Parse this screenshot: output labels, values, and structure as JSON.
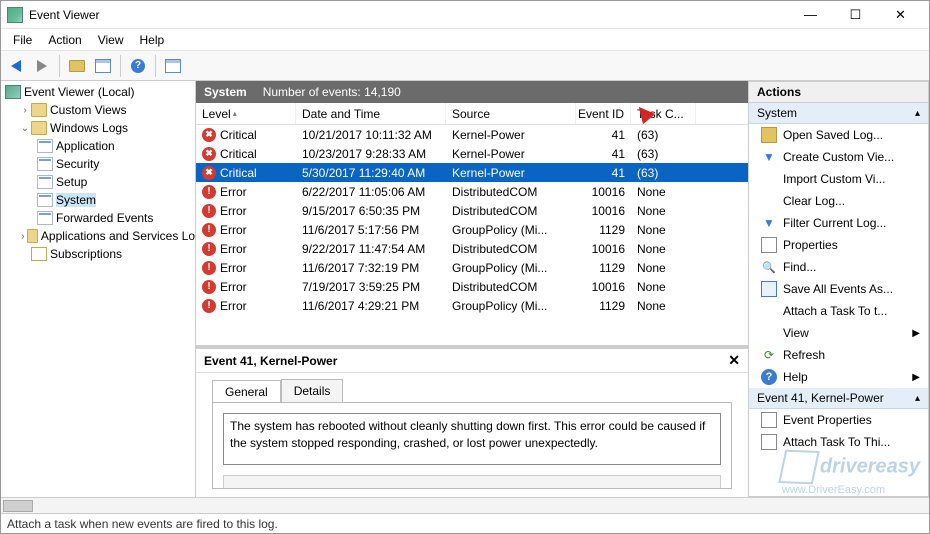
{
  "window": {
    "title": "Event Viewer"
  },
  "menu": [
    "File",
    "Action",
    "View",
    "Help"
  ],
  "tree": {
    "root": "Event Viewer (Local)",
    "custom_views": "Custom Views",
    "windows_logs": "Windows Logs",
    "logs": [
      "Application",
      "Security",
      "Setup",
      "System",
      "Forwarded Events"
    ],
    "app_svc": "Applications and Services Lo",
    "subs": "Subscriptions"
  },
  "center": {
    "title": "System",
    "count_label": "Number of events: 14,190",
    "columns": {
      "level": "Level",
      "date": "Date and Time",
      "source": "Source",
      "id": "Event ID",
      "task": "Task C..."
    },
    "rows": [
      {
        "level": "Critical",
        "icon": "crit",
        "date": "10/21/2017 10:11:32 AM",
        "source": "Kernel-Power",
        "id": "41",
        "task": "(63)"
      },
      {
        "level": "Critical",
        "icon": "crit",
        "date": "10/23/2017 9:28:33 AM",
        "source": "Kernel-Power",
        "id": "41",
        "task": "(63)"
      },
      {
        "level": "Critical",
        "icon": "crit",
        "date": "5/30/2017 11:29:40 AM",
        "source": "Kernel-Power",
        "id": "41",
        "task": "(63)",
        "selected": true
      },
      {
        "level": "Error",
        "icon": "err",
        "date": "6/22/2017 11:05:06 AM",
        "source": "DistributedCOM",
        "id": "10016",
        "task": "None"
      },
      {
        "level": "Error",
        "icon": "err",
        "date": "9/15/2017 6:50:35 PM",
        "source": "DistributedCOM",
        "id": "10016",
        "task": "None"
      },
      {
        "level": "Error",
        "icon": "err",
        "date": "11/6/2017 5:17:56 PM",
        "source": "GroupPolicy (Mi...",
        "id": "1129",
        "task": "None"
      },
      {
        "level": "Error",
        "icon": "err",
        "date": "9/22/2017 11:47:54 AM",
        "source": "DistributedCOM",
        "id": "10016",
        "task": "None"
      },
      {
        "level": "Error",
        "icon": "err",
        "date": "11/6/2017 7:32:19 PM",
        "source": "GroupPolicy (Mi...",
        "id": "1129",
        "task": "None"
      },
      {
        "level": "Error",
        "icon": "err",
        "date": "7/19/2017 3:59:25 PM",
        "source": "DistributedCOM",
        "id": "10016",
        "task": "None"
      },
      {
        "level": "Error",
        "icon": "err",
        "date": "11/6/2017 4:29:21 PM",
        "source": "GroupPolicy (Mi...",
        "id": "1129",
        "task": "None"
      }
    ],
    "details_title": "Event 41, Kernel-Power",
    "tab_general": "General",
    "tab_details": "Details",
    "message": "The system has rebooted without cleanly shutting down first. This error could be caused if the system stopped responding, crashed, or lost power unexpectedly."
  },
  "actions": {
    "title": "Actions",
    "section1": "System",
    "items1": [
      "Open Saved Log...",
      "Create Custom Vie...",
      "Import Custom Vi...",
      "Clear Log...",
      "Filter Current Log...",
      "Properties",
      "Find...",
      "Save All Events As...",
      "Attach a Task To t..."
    ],
    "view": "View",
    "refresh": "Refresh",
    "help": "Help",
    "section2": "Event 41, Kernel-Power",
    "items2": [
      "Event Properties",
      "Attach Task To Thi..."
    ]
  },
  "status": "Attach a task when new events are fired to this log.",
  "watermark": {
    "brand": "drivereasy",
    "url": "www.DriverEasy.com"
  }
}
